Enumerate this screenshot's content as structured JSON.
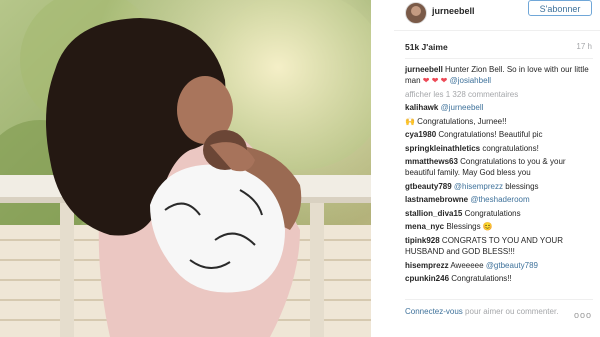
{
  "post": {
    "author": "jurneebell",
    "follow_label": "S'abonner",
    "likes": "51k J'aime",
    "time": "17 h",
    "caption_user": "jurneebell",
    "caption_text": "Hunter Zion Bell. So in love with our little man",
    "caption_hearts": "❤ ❤ ❤",
    "caption_mention": "@josiahbell",
    "load_more": "afficher les 1 328 commentaires"
  },
  "comments": [
    {
      "user": "kalihawk",
      "mention": "@jurneebell",
      "text": ""
    },
    {
      "user": "",
      "mention": "",
      "text": "🙌 Congratulations, Jurnee!!"
    },
    {
      "user": "cya1980",
      "mention": "",
      "text": "Congratulations! Beautiful pic"
    },
    {
      "user": "springkleinathletics",
      "mention": "",
      "text": "congratulations!"
    },
    {
      "user": "mmatthews63",
      "mention": "",
      "text": "Congratulations to you & your beautiful family. May God bless you"
    },
    {
      "user": "gtbeauty789",
      "mention": "@hisemprezz",
      "text": "blessings"
    },
    {
      "user": "lastnamebrowne",
      "mention": "@theshaderoom",
      "text": ""
    },
    {
      "user": "stallion_diva15",
      "mention": "",
      "text": "Congratulations"
    },
    {
      "user": "mena_nyc",
      "mention": "",
      "text": "Blessings 😊"
    },
    {
      "user": "tipink928",
      "mention": "",
      "text": "CONGRATS TO YOU AND YOUR HUSBAND and GOD BLESS!!!"
    },
    {
      "user": "hisemprezz",
      "mention": "@gtbeauty789",
      "text": "Aweeeee"
    },
    {
      "user": "cpunkin246",
      "mention": "",
      "text": "Congratulations!!"
    }
  ],
  "footer": {
    "login_link": "Connectez-vous",
    "login_text": "pour aimer ou commenter.",
    "more_label": "ooo"
  }
}
